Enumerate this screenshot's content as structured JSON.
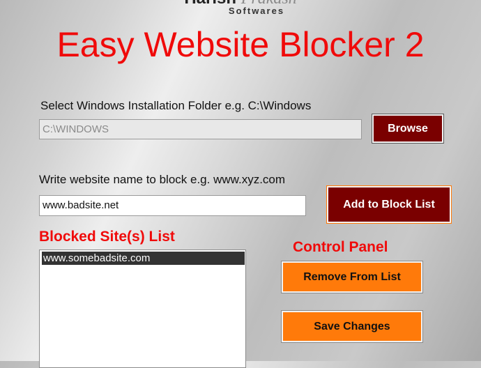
{
  "logo": {
    "brand_bold": "Harish",
    "brand_faded": "Prakash",
    "sub": "Softwares"
  },
  "app": {
    "title": "Easy Website Blocker 2"
  },
  "install_folder": {
    "label": "Select Windows Installation Folder e.g. C:\\Windows",
    "value": "C:\\WINDOWS",
    "browse_label": "Browse"
  },
  "website_input": {
    "label": "Write website name to block e.g. www.xyz.com",
    "value": "www.badsite.net",
    "add_label": "Add to Block List"
  },
  "blocked_list": {
    "heading": "Blocked Site(s) List",
    "items": [
      "www.somebadsite.com"
    ],
    "selected_index": 0
  },
  "control_panel": {
    "heading": "Control Panel",
    "remove_label": "Remove From List",
    "save_label": "Save Changes"
  },
  "colors": {
    "title_red": "#f00a0a",
    "dark_button": "#7a0000",
    "orange_button": "#ff7a0a",
    "selected_row": "#333333"
  }
}
